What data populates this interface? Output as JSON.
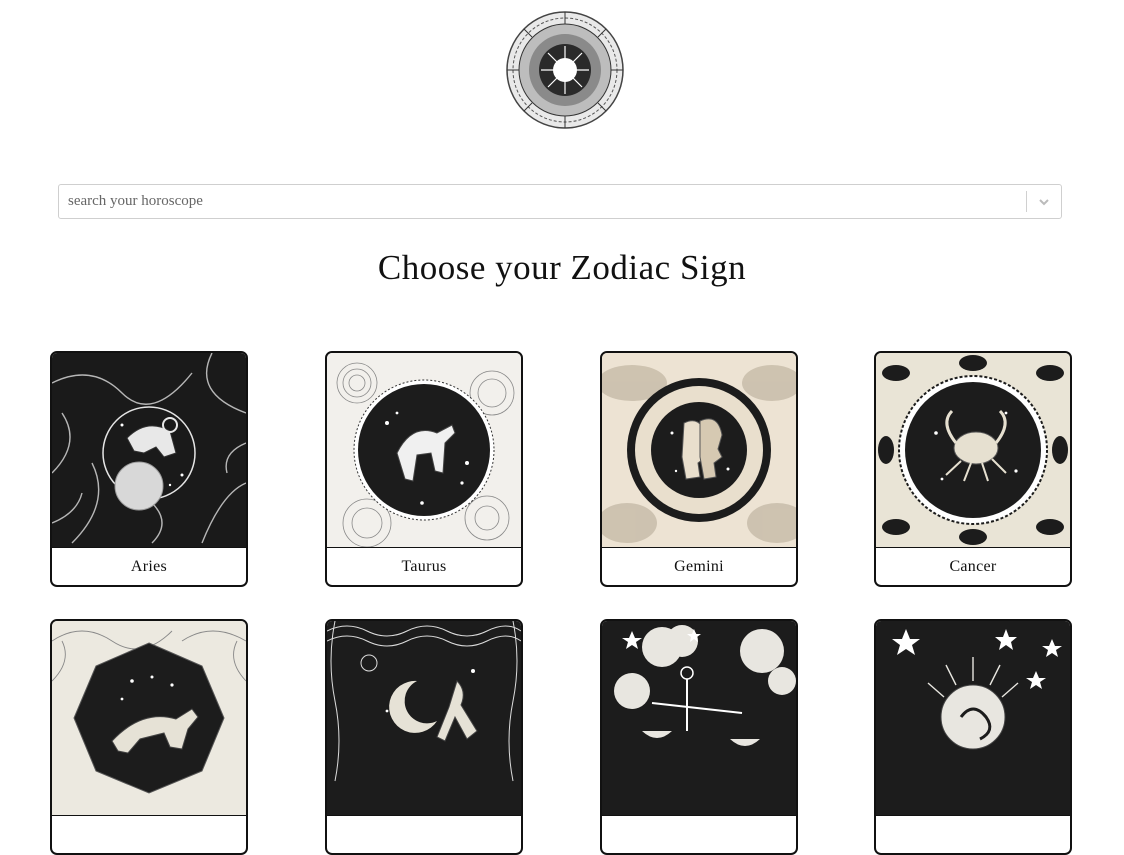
{
  "logo": {
    "icon": "zodiac-wheel-logo-icon"
  },
  "search": {
    "placeholder": "search your horoscope",
    "value": "",
    "dropdown_icon": "chevron-down-icon"
  },
  "heading": "Choose your Zodiac Sign",
  "signs": [
    {
      "label": "Aries",
      "icon": "ram-icon",
      "theme": "dark"
    },
    {
      "label": "Taurus",
      "icon": "bull-icon",
      "theme": "light"
    },
    {
      "label": "Gemini",
      "icon": "twins-icon",
      "theme": "cream"
    },
    {
      "label": "Cancer",
      "icon": "crab-icon",
      "theme": "cream"
    },
    {
      "label": "",
      "icon": "lion-icon",
      "theme": "light"
    },
    {
      "label": "",
      "icon": "maiden-icon",
      "theme": "dark"
    },
    {
      "label": "",
      "icon": "scales-icon",
      "theme": "dark"
    },
    {
      "label": "",
      "icon": "scorpion-icon",
      "theme": "dark"
    }
  ],
  "colors": {
    "ink": "#111111",
    "cream": "#ede3d3",
    "paper": "#f4f1ea"
  }
}
